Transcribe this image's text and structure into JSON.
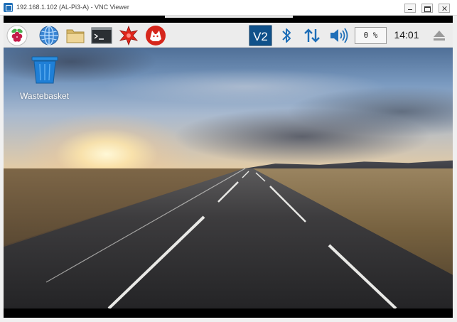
{
  "window": {
    "title": "192.168.1.102 (AL-Pi3-A) - VNC Viewer",
    "icon": "vnc-viewer-icon"
  },
  "taskbar": {
    "launchers": [
      {
        "name": "menu",
        "icon": "raspberry-menu-icon"
      },
      {
        "name": "web-browser",
        "icon": "globe-icon"
      },
      {
        "name": "file-manager",
        "icon": "folder-icon"
      },
      {
        "name": "terminal",
        "icon": "terminal-icon"
      },
      {
        "name": "mathematica",
        "icon": "mathematica-icon"
      },
      {
        "name": "wolfram",
        "icon": "wolfram-icon"
      }
    ],
    "tray": {
      "vnc_label": "V2",
      "cpu_usage": "0 %",
      "clock": "14:01"
    }
  },
  "desktop": {
    "icons": [
      {
        "label": "Wastebasket",
        "icon": "trash-icon"
      }
    ]
  },
  "colors": {
    "taskbar_bg": "#ececec",
    "accent_blue": "#1f6fb8",
    "vnc_icon_bg": "#10518a"
  }
}
